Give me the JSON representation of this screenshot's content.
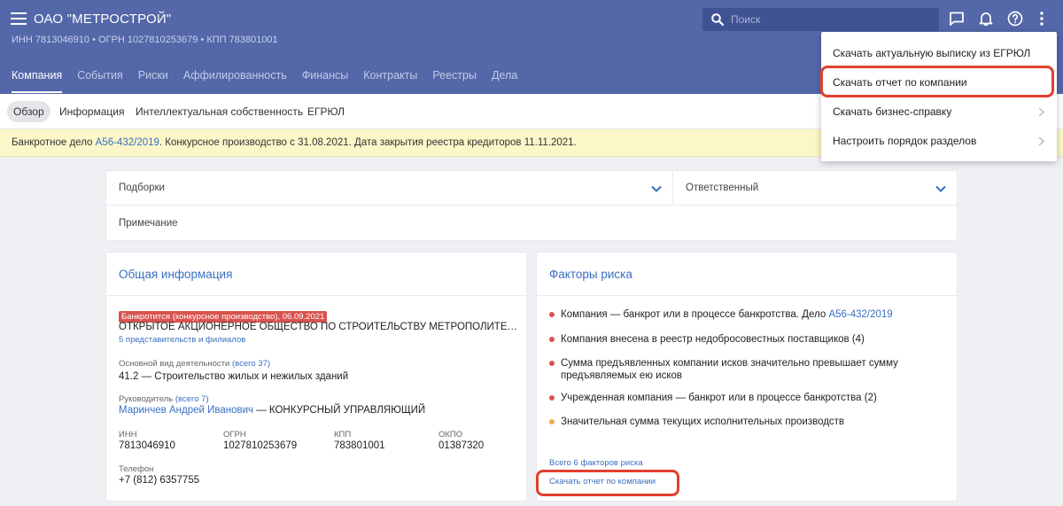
{
  "header": {
    "company_name": "ОАО \"МЕТРОСТРОЙ\"",
    "ids": "ИНН 7813046910  •  ОГРН 1027810253679  •  КПП 783801001",
    "search_placeholder": "Поиск",
    "tabs": [
      "Компания",
      "События",
      "Риски",
      "Аффилированность",
      "Финансы",
      "Контракты",
      "Реестры",
      "Дела"
    ],
    "icons": [
      "menu-icon",
      "search-icon",
      "chat-icon",
      "bell-icon",
      "help-icon",
      "more-vertical-icon"
    ]
  },
  "subnav": {
    "items": [
      "Обзор",
      "Информация",
      "Интеллектуальная собственность",
      "ЕГРЮЛ"
    ]
  },
  "banner": {
    "prefix": "Банкротное дело",
    "case_link": "А56-432/2019",
    "suffix": ". Конкурсное производство с 31.08.2021. Дата закрытия реестра кредиторов 11.11.2021."
  },
  "fields": {
    "collections": "Подборки",
    "responsible": "Ответственный",
    "note": "Примечание"
  },
  "general": {
    "title": "Общая информация",
    "badge": "Банкротится (конкурсное производство), 06.09.2021",
    "full_name": "ОТКРЫТОЕ АКЦИОНЕРНОЕ ОБЩЕСТВО ПО СТРОИТЕЛЬСТВУ МЕТРОПОЛИТЕНА В ГОРОДЕ САНКТ-ПЕТЕРБУРГЕ",
    "branches": "5 представительств и филиалов",
    "activity_label": "Основной вид деятельности",
    "activity_all": "(всего 37)",
    "activity_value": "41.2 — Строительство жилых и нежилых зданий",
    "head_label": "Руководитель",
    "head_all": "(всего 7)",
    "head_name": "Маринчев Андрей Иванович",
    "head_role": " — КОНКУРСНЫЙ УПРАВЛЯЮЩИЙ",
    "inn_label": "ИНН",
    "inn": "7813046910",
    "ogrn_label": "ОГРН",
    "ogrn": "1027810253679",
    "kpp_label": "КПП",
    "kpp": "783801001",
    "okpo_label": "ОКПО",
    "okpo": "01387320",
    "phone_label": "Телефон",
    "phone": "+7 (812) 6357755"
  },
  "risks": {
    "title": "Факторы риска",
    "items": [
      {
        "text": "Компания — банкрот или в процессе банкротства. Дело ",
        "link": "А56-432/2019",
        "color": "#d9534f"
      },
      {
        "text": "Компания внесена в реестр недобросовестных поставщиков (4)",
        "link": "",
        "color": "#d9534f"
      },
      {
        "text": "Сумма предъявленных компании исков значительно превышает сумму предъявляемых ею исков",
        "link": "",
        "color": "#d9534f"
      },
      {
        "text": "Учрежденная компания — банкрот или в процессе банкротства (2)",
        "link": "",
        "color": "#d9534f"
      },
      {
        "text": "Значительная сумма текущих исполнительных производств",
        "link": "",
        "color": "#f0ad4e"
      }
    ],
    "all_link": "Всего 6 факторов риска",
    "download_link": "Скачать отчет по компании"
  },
  "menu": {
    "items": [
      {
        "label": "Скачать актуальную выписку из ЕГРЮЛ",
        "has_submenu": false
      },
      {
        "label": "Скачать отчет по компании",
        "has_submenu": false
      },
      {
        "label": "Скачать бизнес-справку",
        "has_submenu": true
      },
      {
        "label": "Настроить порядок разделов",
        "has_submenu": true
      }
    ]
  },
  "colors": {
    "header_bg": "#5367a9",
    "link": "#3a6fc0",
    "highlight": "#e0402e",
    "danger": "#d9534f",
    "warning": "#f0ad4e",
    "banner_bg": "#fcf7c8"
  }
}
